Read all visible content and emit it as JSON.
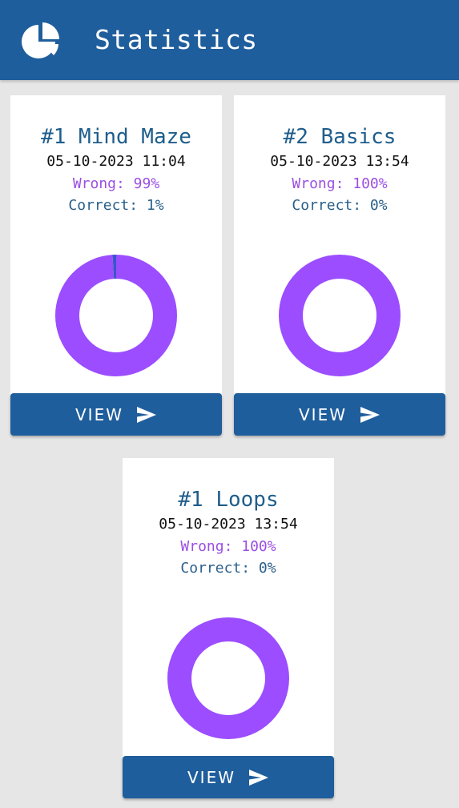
{
  "header": {
    "title": "Statistics",
    "icon": "pie-chart-icon"
  },
  "colors": {
    "primary": "#1f5e9c",
    "title_text": "#1f5e8c",
    "wrong": "#9b4fe3",
    "correct": "#2a5f8a",
    "donut_wrong": "#9b4dff",
    "donut_correct": "#3a55c9",
    "background": "#e6e6e6"
  },
  "cards": [
    {
      "title": "#1 Mind Maze",
      "date": "05-10-2023 11:04",
      "wrong_text": "Wrong: 99%",
      "correct_text": "Correct: 1%",
      "wrong_pct": 99,
      "correct_pct": 1,
      "button_label": "VIEW",
      "button_icon": "send-icon"
    },
    {
      "title": "#2 Basics",
      "date": "05-10-2023 13:54",
      "wrong_text": "Wrong: 100%",
      "correct_text": "Correct: 0%",
      "wrong_pct": 100,
      "correct_pct": 0,
      "button_label": "VIEW",
      "button_icon": "send-icon"
    },
    {
      "title": "#1 Loops",
      "date": "05-10-2023 13:54",
      "wrong_text": "Wrong: 100%",
      "correct_text": "Correct: 0%",
      "wrong_pct": 100,
      "correct_pct": 0,
      "button_label": "VIEW",
      "button_icon": "send-icon"
    }
  ]
}
